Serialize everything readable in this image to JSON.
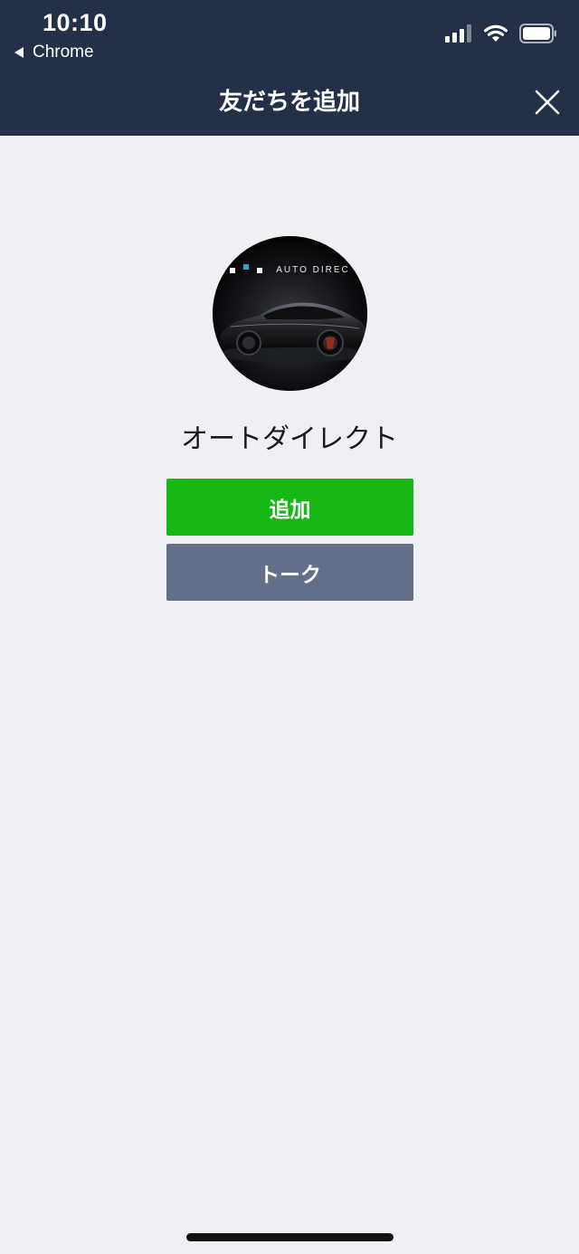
{
  "status_bar": {
    "time": "10:10",
    "back_app_label": "Chrome",
    "icons": [
      "cellular-signal-icon",
      "wifi-icon",
      "battery-icon"
    ]
  },
  "nav": {
    "title": "友だちを追加",
    "close_icon": "close-icon"
  },
  "profile": {
    "name": "オートダイレクト",
    "avatar_brand_text": "AUTO DIREC"
  },
  "actions": {
    "add_label": "追加",
    "talk_label": "トーク"
  },
  "colors": {
    "header_bg": "#233048",
    "page_bg": "#efeff4",
    "add_button": "#17b816",
    "talk_button": "#647089"
  }
}
